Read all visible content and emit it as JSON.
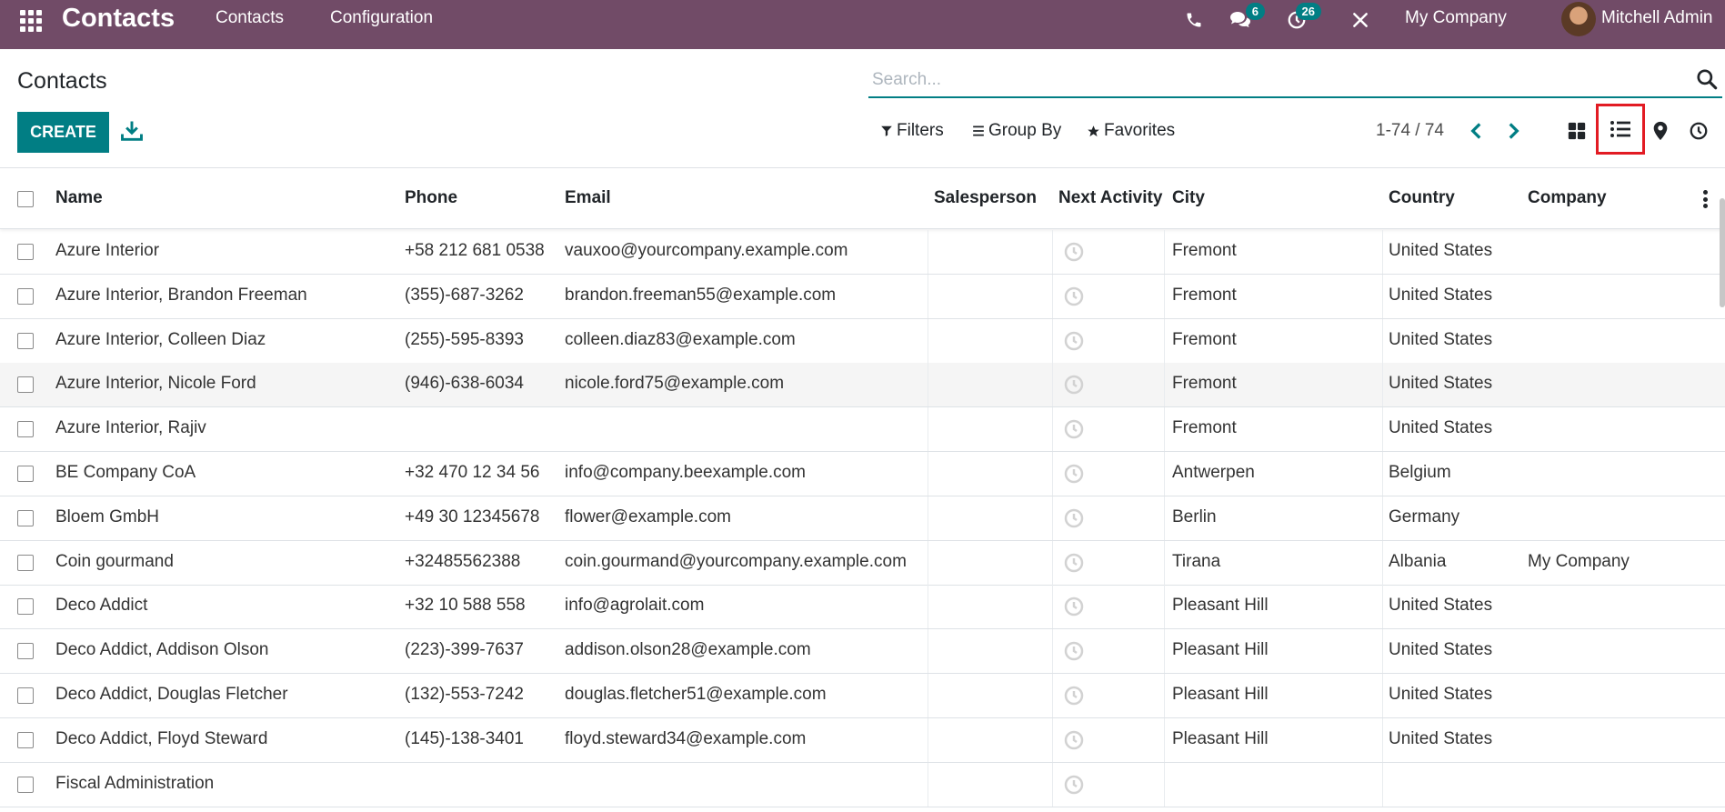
{
  "navbar": {
    "app_title": "Contacts",
    "menu": [
      "Contacts",
      "Configuration"
    ],
    "messages_count": "6",
    "activities_count": "26",
    "company": "My Company",
    "user": "Mitchell Admin"
  },
  "page": {
    "title": "Contacts",
    "search_placeholder": "Search...",
    "create_label": "CREATE",
    "filters_label": "Filters",
    "group_by_label": "Group By",
    "favorites_label": "Favorites",
    "pager": "1-74 / 74",
    "active_view": "list"
  },
  "table": {
    "columns": [
      "Name",
      "Phone",
      "Email",
      "Salesperson",
      "Next Activity",
      "City",
      "Country",
      "Company"
    ],
    "rows": [
      {
        "name": "Azure Interior",
        "phone": "+58 212 681 0538",
        "email": "vauxoo@yourcompany.example.com",
        "salesperson": "",
        "city": "Fremont",
        "country": "United States",
        "company": ""
      },
      {
        "name": "Azure Interior, Brandon Freeman",
        "phone": "(355)-687-3262",
        "email": "brandon.freeman55@example.com",
        "salesperson": "",
        "city": "Fremont",
        "country": "United States",
        "company": ""
      },
      {
        "name": "Azure Interior, Colleen Diaz",
        "phone": "(255)-595-8393",
        "email": "colleen.diaz83@example.com",
        "salesperson": "",
        "city": "Fremont",
        "country": "United States",
        "company": ""
      },
      {
        "name": "Azure Interior, Nicole Ford",
        "phone": "(946)-638-6034",
        "email": "nicole.ford75@example.com",
        "salesperson": "",
        "city": "Fremont",
        "country": "United States",
        "company": ""
      },
      {
        "name": "Azure Interior, Rajiv",
        "phone": "",
        "email": "",
        "salesperson": "",
        "city": "Fremont",
        "country": "United States",
        "company": ""
      },
      {
        "name": "BE Company CoA",
        "phone": "+32 470 12 34 56",
        "email": "info@company.beexample.com",
        "salesperson": "",
        "city": "Antwerpen",
        "country": "Belgium",
        "company": ""
      },
      {
        "name": "Bloem GmbH",
        "phone": "+49 30 12345678",
        "email": "flower@example.com",
        "salesperson": "",
        "city": "Berlin",
        "country": "Germany",
        "company": ""
      },
      {
        "name": "Coin gourmand",
        "phone": "+32485562388",
        "email": "coin.gourmand@yourcompany.example.com",
        "salesperson": "",
        "city": "Tirana",
        "country": "Albania",
        "company": "My Company"
      },
      {
        "name": "Deco Addict",
        "phone": "+32 10 588 558",
        "email": "info@agrolait.com",
        "salesperson": "",
        "city": "Pleasant Hill",
        "country": "United States",
        "company": ""
      },
      {
        "name": "Deco Addict, Addison Olson",
        "phone": "(223)-399-7637",
        "email": "addison.olson28@example.com",
        "salesperson": "",
        "city": "Pleasant Hill",
        "country": "United States",
        "company": ""
      },
      {
        "name": "Deco Addict, Douglas Fletcher",
        "phone": "(132)-553-7242",
        "email": "douglas.fletcher51@example.com",
        "salesperson": "",
        "city": "Pleasant Hill",
        "country": "United States",
        "company": ""
      },
      {
        "name": "Deco Addict, Floyd Steward",
        "phone": "(145)-138-3401",
        "email": "floyd.steward34@example.com",
        "salesperson": "",
        "city": "Pleasant Hill",
        "country": "United States",
        "company": ""
      },
      {
        "name": "Fiscal Administration",
        "phone": "",
        "email": "",
        "salesperson": "",
        "city": "",
        "country": "",
        "company": ""
      }
    ]
  },
  "colors": {
    "navbar": "#714B67",
    "primary": "#017E84",
    "highlight": "#e21b23"
  }
}
